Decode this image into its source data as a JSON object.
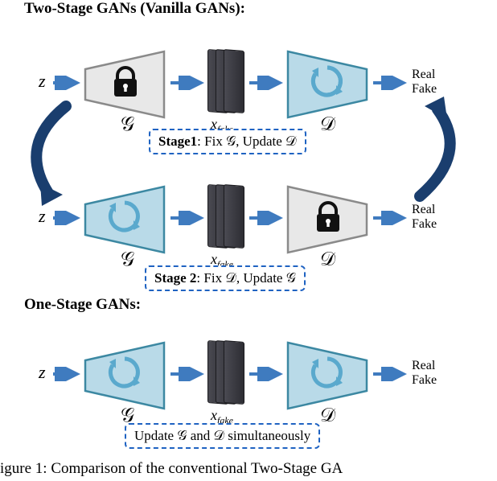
{
  "headings": {
    "two_stage": "Two-Stage GANs (Vanilla GANs):",
    "one_stage": "One-Stage GANs:"
  },
  "labels": {
    "z": "z",
    "G": "𝒢",
    "D": "𝒟",
    "x_fake_var": "x",
    "x_fake_sub": "fake",
    "real": "Real",
    "fake": "Fake"
  },
  "stages": {
    "stage1_label": "Stage1",
    "stage1_text": ": Fix 𝒢, Update 𝒟",
    "stage2_label": "Stage 2",
    "stage2_text": ": Fix 𝒟, Update 𝒢",
    "onestage_text": "Update 𝒢 and 𝒟 simultaneously"
  },
  "colors": {
    "blue_fill": "#b9dae8",
    "blue_stroke": "#3c88a2",
    "gray_fill": "#e8e8e8",
    "gray_stroke": "#8a8a8a",
    "arrow_blue": "#3f7bbf",
    "dark_arc": "#1a3e6e"
  },
  "caption": "igure 1: Comparison of the conventional Two-Stage GA",
  "chart_data": {
    "type": "diagram",
    "rows": [
      {
        "name": "two_stage_row1",
        "G_state": "locked",
        "D_state": "updating",
        "stage": "Stage1: Fix G, Update D"
      },
      {
        "name": "two_stage_row2",
        "G_state": "updating",
        "D_state": "locked",
        "stage": "Stage 2: Fix D, Update G"
      },
      {
        "name": "one_stage_row",
        "G_state": "updating",
        "D_state": "updating",
        "stage": "Update G and D simultaneously"
      }
    ],
    "flow": "z -> G -> x_fake -> D -> Real/Fake"
  }
}
